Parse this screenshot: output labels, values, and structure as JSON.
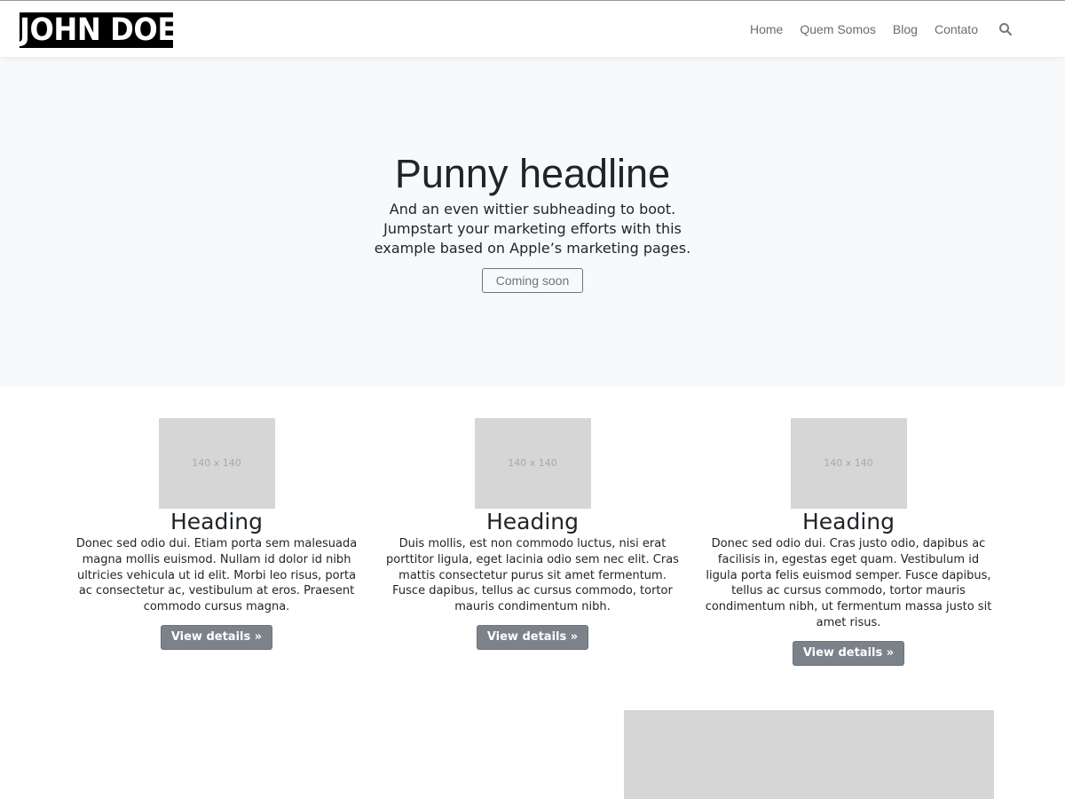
{
  "navbar": {
    "logo_text": "JOHN DOE",
    "links": [
      "Home",
      "Quem Somos",
      "Blog",
      "Contato"
    ],
    "search_icon": "search-icon"
  },
  "hero": {
    "title": "Punny headline",
    "subtitle": "And an even wittier subheading to boot. Jumpstart your marketing efforts with this example based on Apple’s marketing pages.",
    "button_label": "Coming soon"
  },
  "features": [
    {
      "image_label": "140 x 140",
      "heading": "Heading",
      "text": "Donec sed odio dui. Etiam porta sem malesuada magna mollis euismod. Nullam id dolor id nibh ultricies vehicula ut id elit. Morbi leo risus, porta ac consectetur ac, vestibulum at eros. Praesent commodo cursus magna.",
      "button_label": "View details »"
    },
    {
      "image_label": "140 x 140",
      "heading": "Heading",
      "text": "Duis mollis, est non commodo luctus, nisi erat porttitor ligula, eget lacinia odio sem nec elit. Cras mattis consectetur purus sit amet fermentum. Fusce dapibus, tellus ac cursus commodo, tortor mauris condimentum nibh.",
      "button_label": "View details »"
    },
    {
      "image_label": "140 x 140",
      "heading": "Heading",
      "text": "Donec sed odio dui. Cras justo odio, dapibus ac facilisis in, egestas eget quam. Vestibulum id ligula porta felis euismod semper. Fusce dapibus, tellus ac cursus commodo, tortor mauris condimentum nibh, ut fermentum massa justo sit amet risus.",
      "button_label": "View details »"
    }
  ],
  "colors": {
    "hero_background": "#f8f9fa",
    "placeholder": "#d6d6d6",
    "button_secondary": "#6c757d",
    "text": "#212529"
  }
}
